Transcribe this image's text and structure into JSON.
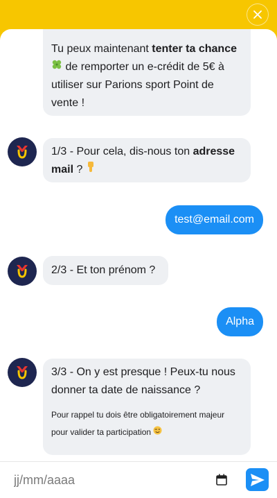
{
  "header": {
    "close_icon": "close-icon"
  },
  "messages": [
    {
      "from": "bot",
      "avatar": false,
      "parts": [
        "Tu peux maintenant ",
        "tenter ta chance",
        " de remporter un e-crédit de 5€ à utiliser sur Parions sport Point de vente !"
      ],
      "emoji": "clover"
    },
    {
      "from": "bot",
      "avatar": true,
      "parts": [
        "1/3 - Pour cela, dis-nous ton ",
        "adresse mail",
        " ? "
      ],
      "emoji": "pointing-down"
    },
    {
      "from": "user",
      "text": "test@email.com"
    },
    {
      "from": "bot",
      "avatar": true,
      "text": "2/3 - Et ton prénom ?"
    },
    {
      "from": "user",
      "text": "Alpha"
    },
    {
      "from": "bot",
      "avatar": true,
      "text": "3/3 - On y est presque ! Peux-tu nous donner ta date de naissance ?",
      "note": "Pour rappel tu dois être obligatoirement majeur pour valider ta participation",
      "emoji": "wink"
    }
  ],
  "composer": {
    "placeholder": "jj/mm/aaaa",
    "calendar_icon": "calendar-icon",
    "send_icon": "send-icon"
  },
  "colors": {
    "brand_yellow": "#f7c600",
    "user_bubble": "#1b8ff5",
    "bot_bubble": "#eef0f3",
    "avatar_bg": "#1e2650"
  }
}
